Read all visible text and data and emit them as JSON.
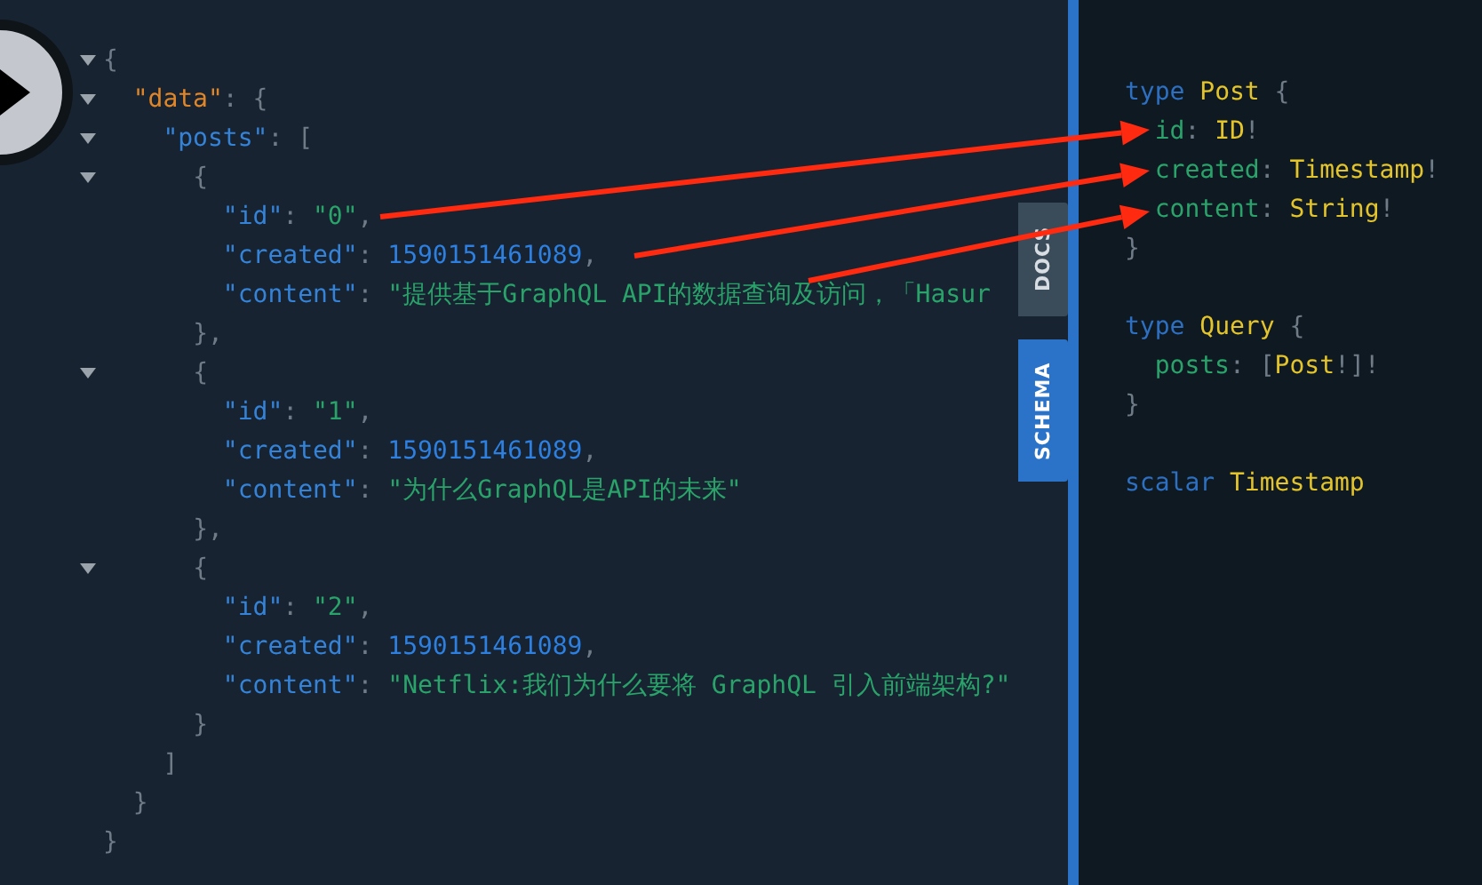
{
  "result": {
    "expanded": true,
    "tokens": [
      {
        "kind": "punct",
        "text": "{"
      }
    ],
    "close": [
      {
        "kind": "punct",
        "text": "}"
      }
    ],
    "children": [
      {
        "expanded": true,
        "tokens": [
          {
            "kind": "root-key",
            "text": "\"data\""
          },
          {
            "kind": "punct",
            "text": ": {"
          }
        ],
        "close": [
          {
            "kind": "punct",
            "text": "}"
          }
        ],
        "children": [
          {
            "expanded": true,
            "tokens": [
              {
                "kind": "key",
                "text": "\"posts\""
              },
              {
                "kind": "punct",
                "text": ": ["
              }
            ],
            "close": [
              {
                "kind": "punct",
                "text": "]"
              }
            ],
            "children": [
              {
                "expanded": true,
                "tokens": [
                  {
                    "kind": "punct",
                    "text": "{"
                  }
                ],
                "close": [
                  {
                    "kind": "punct",
                    "text": "},"
                  }
                ],
                "children": [
                  {
                    "tokens": [
                      {
                        "kind": "key",
                        "text": "\"id\""
                      },
                      {
                        "kind": "punct",
                        "text": ": "
                      },
                      {
                        "kind": "string",
                        "text": "\"0\""
                      },
                      {
                        "kind": "punct",
                        "text": ","
                      }
                    ]
                  },
                  {
                    "tokens": [
                      {
                        "kind": "key",
                        "text": "\"created\""
                      },
                      {
                        "kind": "punct",
                        "text": ": "
                      },
                      {
                        "kind": "number",
                        "text": "1590151461089"
                      },
                      {
                        "kind": "punct",
                        "text": ","
                      }
                    ]
                  },
                  {
                    "tokens": [
                      {
                        "kind": "key",
                        "text": "\"content\""
                      },
                      {
                        "kind": "punct",
                        "text": ": "
                      },
                      {
                        "kind": "string",
                        "text": "\"提供基于GraphQL API的数据查询及访问，「Hasur"
                      }
                    ]
                  }
                ]
              },
              {
                "expanded": true,
                "tokens": [
                  {
                    "kind": "punct",
                    "text": "{"
                  }
                ],
                "close": [
                  {
                    "kind": "punct",
                    "text": "},"
                  }
                ],
                "children": [
                  {
                    "tokens": [
                      {
                        "kind": "key",
                        "text": "\"id\""
                      },
                      {
                        "kind": "punct",
                        "text": ": "
                      },
                      {
                        "kind": "string",
                        "text": "\"1\""
                      },
                      {
                        "kind": "punct",
                        "text": ","
                      }
                    ]
                  },
                  {
                    "tokens": [
                      {
                        "kind": "key",
                        "text": "\"created\""
                      },
                      {
                        "kind": "punct",
                        "text": ": "
                      },
                      {
                        "kind": "number",
                        "text": "1590151461089"
                      },
                      {
                        "kind": "punct",
                        "text": ","
                      }
                    ]
                  },
                  {
                    "tokens": [
                      {
                        "kind": "key",
                        "text": "\"content\""
                      },
                      {
                        "kind": "punct",
                        "text": ": "
                      },
                      {
                        "kind": "string",
                        "text": "\"为什么GraphQL是API的未来\""
                      }
                    ]
                  }
                ]
              },
              {
                "expanded": true,
                "tokens": [
                  {
                    "kind": "punct",
                    "text": "{"
                  }
                ],
                "close": [
                  {
                    "kind": "punct",
                    "text": "}"
                  }
                ],
                "children": [
                  {
                    "tokens": [
                      {
                        "kind": "key",
                        "text": "\"id\""
                      },
                      {
                        "kind": "punct",
                        "text": ": "
                      },
                      {
                        "kind": "string",
                        "text": "\"2\""
                      },
                      {
                        "kind": "punct",
                        "text": ","
                      }
                    ]
                  },
                  {
                    "tokens": [
                      {
                        "kind": "key",
                        "text": "\"created\""
                      },
                      {
                        "kind": "punct",
                        "text": ": "
                      },
                      {
                        "kind": "number",
                        "text": "1590151461089"
                      },
                      {
                        "kind": "punct",
                        "text": ","
                      }
                    ]
                  },
                  {
                    "tokens": [
                      {
                        "kind": "key",
                        "text": "\"content\""
                      },
                      {
                        "kind": "punct",
                        "text": ": "
                      },
                      {
                        "kind": "string",
                        "text": "\"Netflix:我们为什么要将 GraphQL 引入前端架构?\""
                      }
                    ]
                  }
                ]
              }
            ]
          }
        ]
      }
    ]
  },
  "tabs": [
    {
      "label": "DOCS",
      "selected": false
    },
    {
      "label": "SCHEMA",
      "selected": true
    }
  ],
  "schema": [
    {
      "tokens": [
        {
          "kind": "keyword",
          "text": "type"
        },
        {
          "kind": "type",
          "text": "Post"
        },
        {
          "kind": "punct",
          "text": " {"
        }
      ],
      "close": [
        {
          "kind": "punct",
          "text": "}"
        }
      ],
      "children": [
        {
          "tokens": [
            {
              "kind": "field",
              "text": "id"
            },
            {
              "kind": "punct",
              "text": ": "
            },
            {
              "kind": "type",
              "text": "ID"
            },
            {
              "kind": "punct",
              "text": "!"
            }
          ]
        },
        {
          "tokens": [
            {
              "kind": "field",
              "text": "created"
            },
            {
              "kind": "punct",
              "text": ": "
            },
            {
              "kind": "type",
              "text": "Timestamp"
            },
            {
              "kind": "punct",
              "text": "!"
            }
          ]
        },
        {
          "tokens": [
            {
              "kind": "field",
              "text": "content"
            },
            {
              "kind": "punct",
              "text": ": "
            },
            {
              "kind": "type",
              "text": "String"
            },
            {
              "kind": "punct",
              "text": "!"
            }
          ]
        }
      ]
    },
    {
      "tokens": [
        {
          "kind": "keyword",
          "text": "type"
        },
        {
          "kind": "type",
          "text": "Query"
        },
        {
          "kind": "punct",
          "text": " {"
        }
      ],
      "close": [
        {
          "kind": "punct",
          "text": "}"
        }
      ],
      "children": [
        {
          "tokens": [
            {
              "kind": "field",
              "text": "posts"
            },
            {
              "kind": "punct",
              "text": ": ["
            },
            {
              "kind": "type",
              "text": "Post"
            },
            {
              "kind": "punct",
              "text": "!]!"
            }
          ]
        }
      ]
    },
    {
      "tokens": [
        {
          "kind": "keyword",
          "text": "scalar"
        },
        {
          "kind": "type",
          "text": "Timestamp"
        }
      ]
    }
  ]
}
